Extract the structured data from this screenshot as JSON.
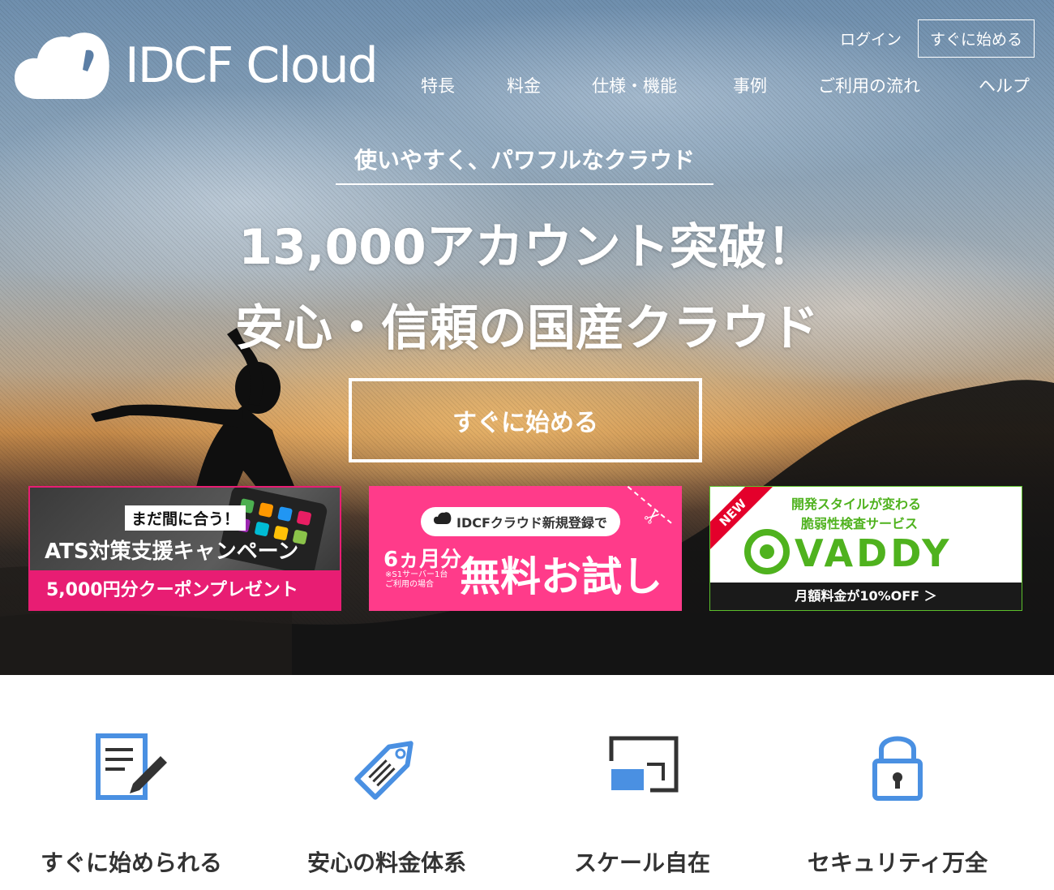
{
  "brand": {
    "name": "IDCF Cloud"
  },
  "header": {
    "login_label": "ログイン",
    "start_label": "すぐに始める",
    "nav": [
      "特長",
      "料金",
      "仕様・機能",
      "事例",
      "ご利用の流れ",
      "ヘルプ"
    ]
  },
  "hero": {
    "tagline": "使いやすく、パワフルなクラウド",
    "headline1": "13,000アカウント突破！",
    "headline2": "安心・信頼の国産クラウド",
    "cta_label": "すぐに始める"
  },
  "banners": {
    "ats": {
      "pill": "まだ間に合う！",
      "title": "ATS対策支援キャンペーン",
      "coupon": "5,000円分クーポンプレゼント"
    },
    "trial": {
      "pill": "IDCFクラウド新規登録で",
      "months": "6ヵ月分",
      "note_line1": "※S1サーバー1台",
      "note_line2": "ご利用の場合",
      "headline": "無料お試し"
    },
    "vaddy": {
      "ribbon": "NEW",
      "line1": "開発スタイルが変わる",
      "line2": "脆弱性検査サービス",
      "logo_text": "VADDY",
      "offer": "月額料金が10%OFF ＞"
    }
  },
  "features": [
    {
      "label": "すぐに始められる",
      "icon": "document-edit-icon"
    },
    {
      "label": "安心の料金体系",
      "icon": "price-tag-icon"
    },
    {
      "label": "スケール自在",
      "icon": "scale-screen-icon"
    },
    {
      "label": "セキュリティ万全",
      "icon": "lock-icon"
    }
  ],
  "colors": {
    "accent_pink": "#e81d73",
    "trial_pink": "#ff3b8a",
    "vaddy_green": "#4fb21e",
    "icon_blue": "#4a90e2"
  }
}
